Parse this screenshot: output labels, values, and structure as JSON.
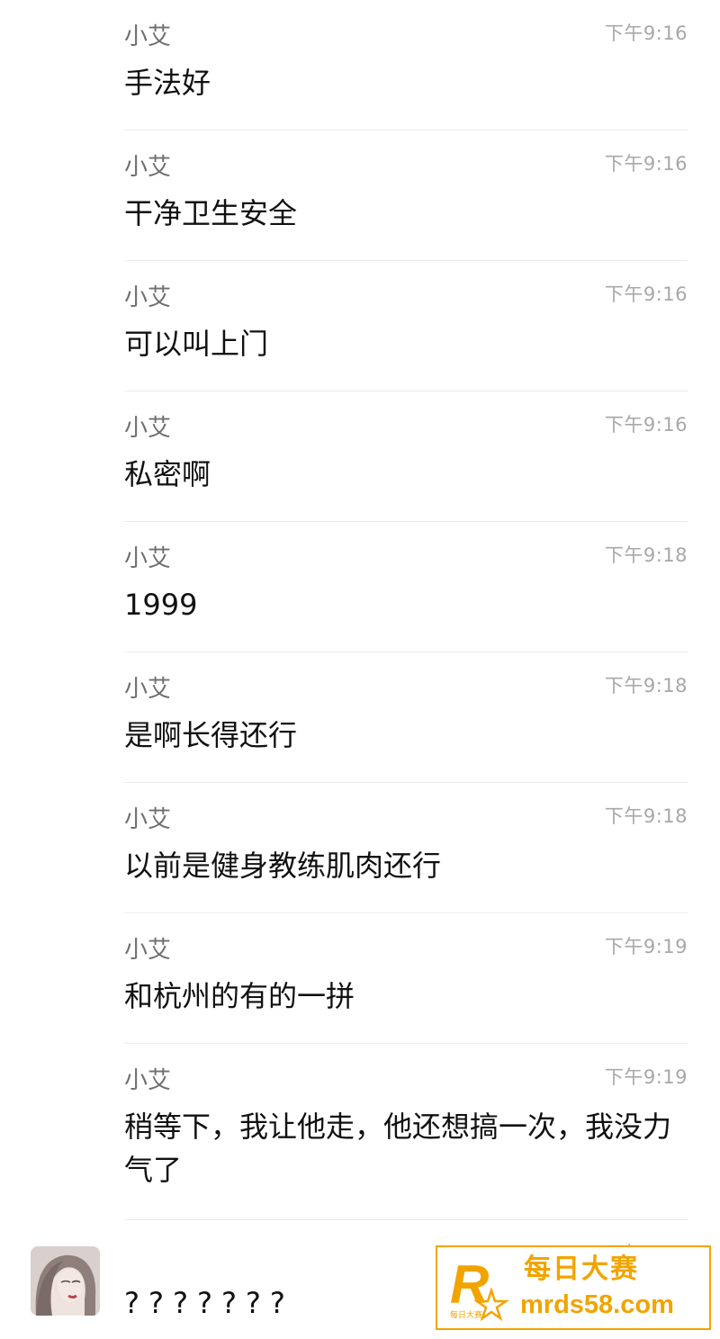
{
  "messages": [
    {
      "sender": "小艾",
      "time": "下午9:16",
      "text": "手法好"
    },
    {
      "sender": "小艾",
      "time": "下午9:16",
      "text": "干净卫生安全"
    },
    {
      "sender": "小艾",
      "time": "下午9:16",
      "text": "可以叫上门"
    },
    {
      "sender": "小艾",
      "time": "下午9:16",
      "text": "私密啊"
    },
    {
      "sender": "小艾",
      "time": "下午9:18",
      "text": "1999"
    },
    {
      "sender": "小艾",
      "time": "下午9:18",
      "text": "是啊长得还行"
    },
    {
      "sender": "小艾",
      "time": "下午9:18",
      "text": "以前是健身教练肌肉还行"
    },
    {
      "sender": "小艾",
      "time": "下午9:19",
      "text": "和杭州的有的一拼"
    },
    {
      "sender": "小艾",
      "time": "下午9:19",
      "text": "稍等下，我让他走，他还想搞一次，我没力气了"
    }
  ],
  "last_message": {
    "time": "下午9:19",
    "text": "???????"
  },
  "watermark": {
    "logo_letter": "R",
    "logo_subtext": "每日大赛",
    "title": "每日大赛",
    "url": "mrds58.com",
    "color": "#f1a400"
  }
}
